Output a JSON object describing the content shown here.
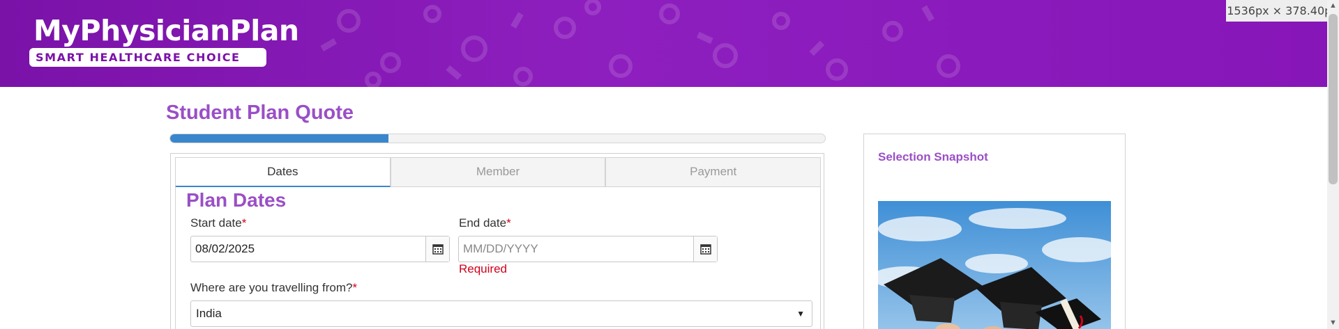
{
  "brand": {
    "name": "MyPhysicianPlan",
    "tagline": "SMART HEALTHCARE CHOICE"
  },
  "dimension_tooltip": "1536px × 378.40px",
  "page_title": "Student Plan Quote",
  "progress": {
    "fraction": 0.333
  },
  "tabs": [
    {
      "label": "Dates",
      "active": true
    },
    {
      "label": "Member",
      "active": false
    },
    {
      "label": "Payment",
      "active": false
    }
  ],
  "section_title": "Plan Dates",
  "form": {
    "start_date": {
      "label": "Start date",
      "required_mark": "*",
      "value": "08/02/2025"
    },
    "end_date": {
      "label": "End date",
      "required_mark": "*",
      "placeholder": "MM/DD/YYYY",
      "error": "Required"
    },
    "travel_from": {
      "label": "Where are you travelling from?",
      "required_mark": "*",
      "value": "India"
    }
  },
  "snapshot": {
    "title": "Selection Snapshot"
  },
  "icons": {
    "calendar": "calendar-icon",
    "dropdown": "chevron-down-icon",
    "graduation": "graduation-caps-image"
  },
  "colors": {
    "brand_purple": "#8e1fbf",
    "heading_purple": "#9a4fc6",
    "progress_blue": "#3a86cc",
    "error_red": "#d0021b"
  }
}
